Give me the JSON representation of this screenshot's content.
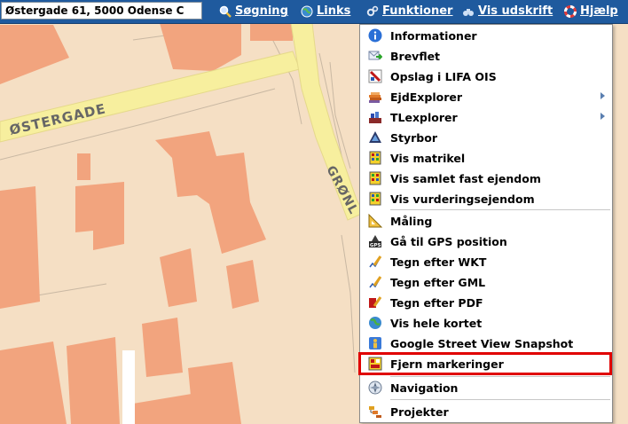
{
  "toolbar": {
    "address_value": "Østergade 61, 5000 Odense C",
    "search_label": "Søgning",
    "links_label": "Links",
    "functions_label": "Funktioner",
    "print_label": "Vis udskrift",
    "help_label": "Hjælp"
  },
  "map": {
    "street_label_1": "ØSTERGADE",
    "street_label_2": "GRØNL"
  },
  "menu": {
    "items": [
      {
        "label": "Informationer",
        "icon": "info-icon"
      },
      {
        "label": "Brevflet",
        "icon": "mail-merge-icon"
      },
      {
        "label": "Opslag i LIFA OIS",
        "icon": "lookup-icon"
      },
      {
        "label": "EjdExplorer",
        "icon": "ejd-explorer-icon",
        "submenu": true
      },
      {
        "label": "TLexplorer",
        "icon": "tl-explorer-icon",
        "submenu": true
      },
      {
        "label": "Styrbor",
        "icon": "styrbor-icon"
      },
      {
        "label": "Vis matrikel",
        "icon": "matrikel-icon"
      },
      {
        "label": "Vis samlet fast ejendom",
        "icon": "property-icon"
      },
      {
        "label": "Vis vurderingsejendom",
        "icon": "valuation-icon"
      },
      {
        "label": "Måling",
        "icon": "measure-icon"
      },
      {
        "label": "Gå til GPS position",
        "icon": "gps-icon"
      },
      {
        "label": "Tegn efter WKT",
        "icon": "draw-wkt-icon"
      },
      {
        "label": "Tegn efter GML",
        "icon": "draw-gml-icon"
      },
      {
        "label": "Tegn efter PDF",
        "icon": "draw-pdf-icon"
      },
      {
        "label": "Vis hele kortet",
        "icon": "globe-icon"
      },
      {
        "label": "Google Street View Snapshot",
        "icon": "street-view-icon"
      },
      {
        "label": "Fjern markeringer",
        "icon": "remove-markings-icon",
        "highlighted": true
      },
      {
        "label": "Navigation",
        "icon": "navigation-icon"
      },
      {
        "label": "Projekter",
        "icon": "projects-icon"
      }
    ]
  },
  "colors": {
    "toolbar_bg": "#1f5a9e",
    "map_bg": "#f5dfc4",
    "building": "#f2a47e",
    "road": "#f7ef9e",
    "highlight": "#e00000"
  }
}
